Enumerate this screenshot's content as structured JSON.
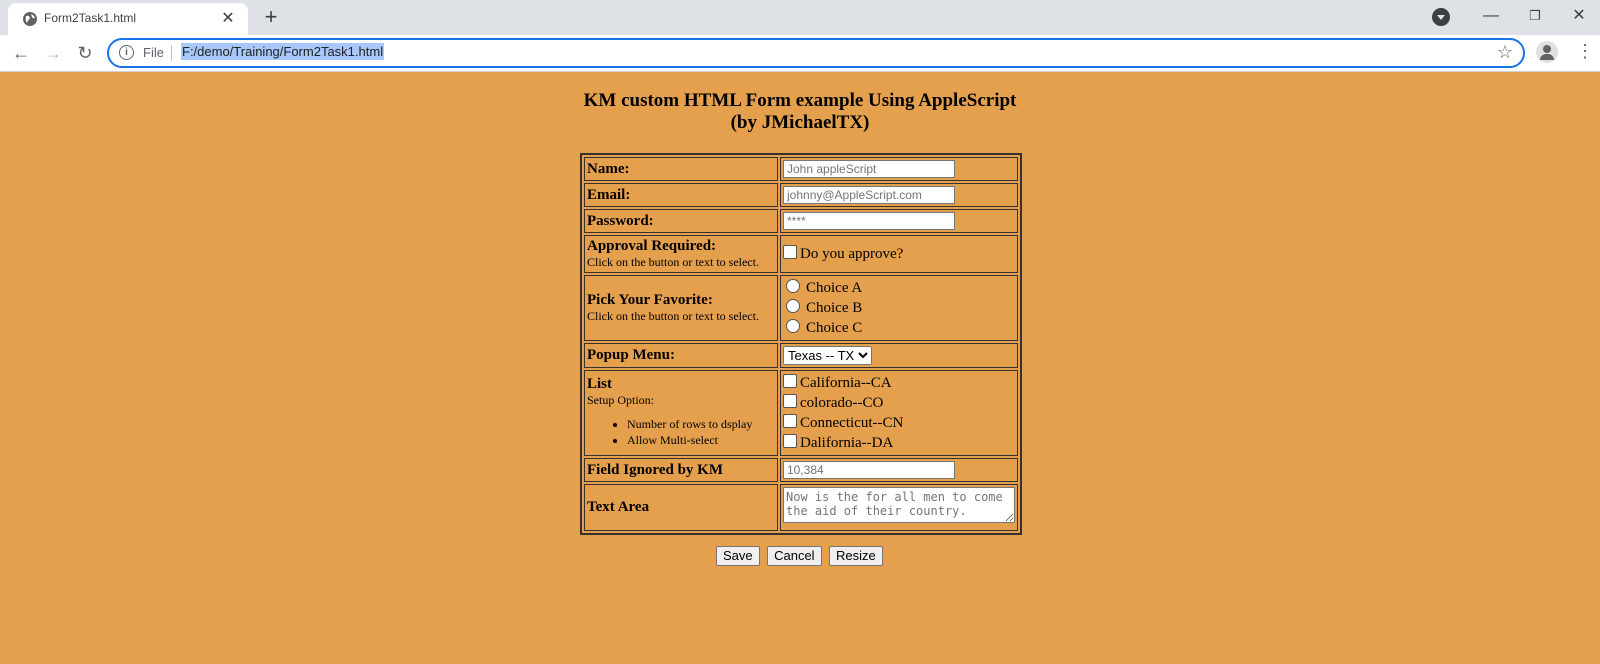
{
  "browser": {
    "tab_title": "Form2Task1.html",
    "address_scheme_label": "File",
    "url": "F:/demo/Training/Form2Task1.html"
  },
  "page": {
    "heading_line1": "KM custom HTML Form example Using AppleScript",
    "heading_line2": "(by JMichaelTX)"
  },
  "form": {
    "name": {
      "label": "Name:",
      "placeholder": "John appleScript"
    },
    "email": {
      "label": "Email:",
      "placeholder": "johnny@AppleScript.com"
    },
    "password": {
      "label": "Password:",
      "placeholder": "****"
    },
    "approval": {
      "label": "Approval Required:",
      "sublabel": "Click on the button or text to select.",
      "checkbox_label": "Do you approve?",
      "checked": false
    },
    "favorite": {
      "label": "Pick Your Favorite:",
      "sublabel": "Click on the button or text to select.",
      "choices": [
        "Choice A",
        "Choice B",
        "Choice C"
      ]
    },
    "popup": {
      "label": "Popup Menu:",
      "selected": "Texas -- TX"
    },
    "list": {
      "label": "List",
      "sublabel": "Setup Option:",
      "bullets": [
        "Number of rows to dsplay",
        "Allow Multi-select"
      ],
      "items": [
        "California--CA",
        "colorado--CO",
        "Connecticut--CN",
        "Dalifornia--DA"
      ]
    },
    "ignored": {
      "label": "Field Ignored by KM",
      "placeholder": "10,384"
    },
    "textarea": {
      "label": "Text Area",
      "placeholder": "Now is the for all men to come the aid of their country."
    }
  },
  "buttons": {
    "save": "Save",
    "cancel": "Cancel",
    "resize": "Resize"
  },
  "colors": {
    "page_background": "#e5a04e",
    "chrome_background": "#dee1e6",
    "focus_ring": "#1a73e8"
  }
}
